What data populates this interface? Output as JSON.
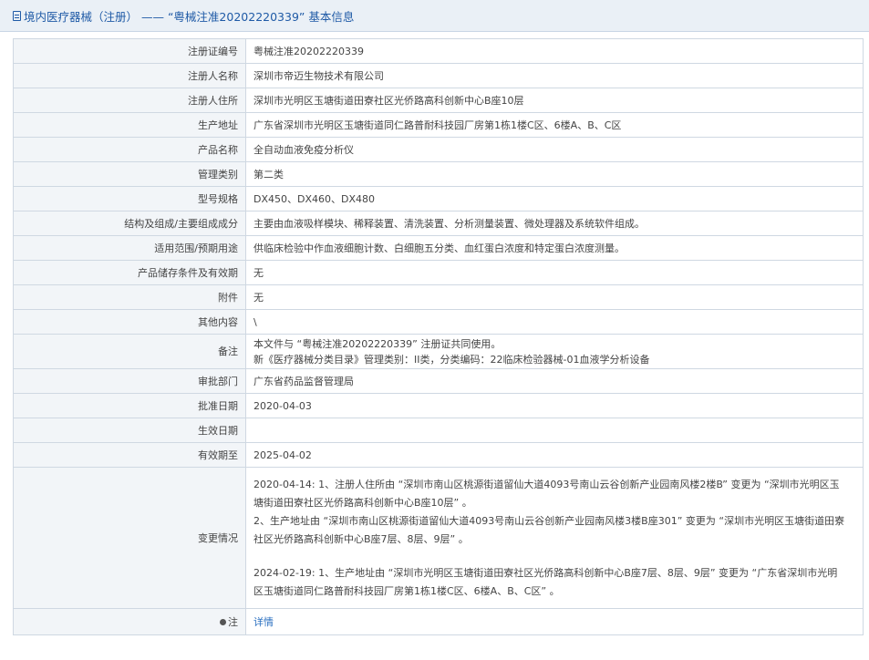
{
  "header": {
    "title": "境内医疗器械（注册） —— “粤械注准20202220339” 基本信息"
  },
  "rows": [
    {
      "label": "注册证编号",
      "value": "粤械注准20202220339"
    },
    {
      "label": "注册人名称",
      "value": "深圳市帝迈生物技术有限公司"
    },
    {
      "label": "注册人住所",
      "value": "深圳市光明区玉塘街道田寮社区光侨路高科创新中心B座10层"
    },
    {
      "label": "生产地址",
      "value": "广东省深圳市光明区玉塘街道同仁路普耐科技园厂房第1栋1楼C区、6楼A、B、C区"
    },
    {
      "label": "产品名称",
      "value": "全自动血液免疫分析仪"
    },
    {
      "label": "管理类别",
      "value": "第二类"
    },
    {
      "label": "型号规格",
      "value": "DX450、DX460、DX480"
    },
    {
      "label": "结构及组成/主要组成成分",
      "value": "主要由血液吸样模块、稀释装置、清洗装置、分析测量装置、微处理器及系统软件组成。"
    },
    {
      "label": "适用范围/预期用途",
      "value": "供临床检验中作血液细胞计数、白细胞五分类、血红蛋白浓度和特定蛋白浓度测量。"
    },
    {
      "label": "产品储存条件及有效期",
      "value": "无"
    },
    {
      "label": "附件",
      "value": "无"
    },
    {
      "label": "其他内容",
      "value": "\\"
    }
  ],
  "remark": {
    "label": "备注",
    "line1": "本文件与 “粤械注准20202220339” 注册证共同使用。",
    "line2": "新《医疗器械分类目录》管理类别：II类，分类编码：22临床检验器械-01血液学分析设备"
  },
  "rows2": [
    {
      "label": "审批部门",
      "value": "广东省药品监督管理局"
    },
    {
      "label": "批准日期",
      "value": "2020-04-03"
    },
    {
      "label": "生效日期",
      "value": ""
    },
    {
      "label": "有效期至",
      "value": "2025-04-02"
    }
  ],
  "changes": {
    "label": "变更情况",
    "l1": "2020-04-14: 1、注册人住所由 “深圳市南山区桃源街道留仙大道4093号南山云谷创新产业园南风楼2楼B” 变更为 “深圳市光明区玉",
    "l2": "塘街道田寮社区光侨路高科创新中心B座10层” 。",
    "l3": "2、生产地址由 “深圳市南山区桃源街道留仙大道4093号南山云谷创新产业园南风楼3楼B座301” 变更为 “深圳市光明区玉塘街道田寮",
    "l4": "社区光侨路高科创新中心B座7层、8层、9层” 。",
    "l5": "2024-02-19: 1、生产地址由 “深圳市光明区玉塘街道田寮社区光侨路高科创新中心B座7层、8层、9层” 变更为 “广东省深圳市光明",
    "l6": "区玉塘街道同仁路普耐科技园厂房第1栋1楼C区、6楼A、B、C区” 。"
  },
  "note": {
    "label": "注",
    "link": "详情",
    "icon": "pin-icon"
  },
  "colors": {
    "accent": "#1f5aa6",
    "link": "#2a6fc0",
    "label_bg": "#f2f5f8",
    "border": "#cfd8e2"
  }
}
